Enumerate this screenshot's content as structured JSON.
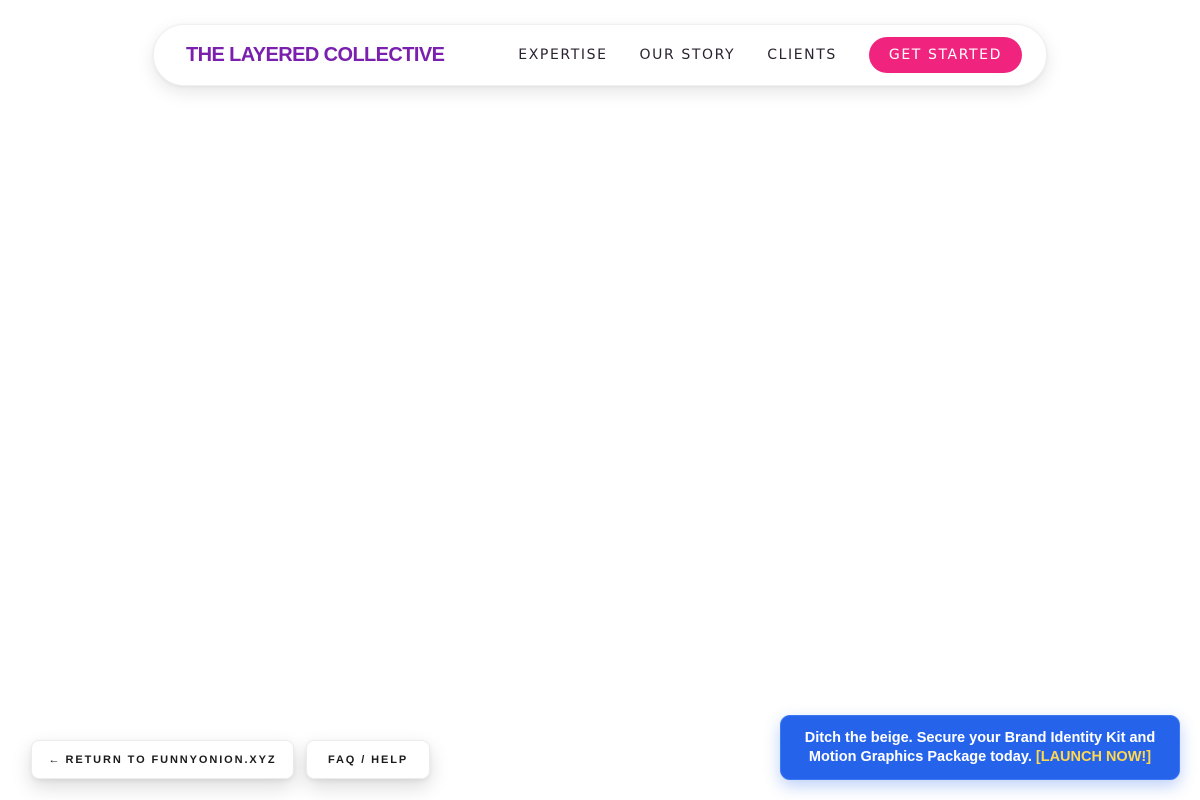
{
  "header": {
    "brand": "THE LAYERED COLLECTIVE",
    "nav": [
      {
        "label": "EXPERTISE"
      },
      {
        "label": "OUR STORY"
      },
      {
        "label": "CLIENTS"
      }
    ],
    "cta_label": "GET STARTED"
  },
  "footer_buttons": {
    "return_arrow": "←",
    "return_label": "RETURN TO FUNNYONION.XYZ",
    "faq_label": "FAQ / HELP"
  },
  "promo": {
    "message": "Ditch the beige. Secure your Brand Identity Kit and Motion Graphics Package today.",
    "link_label": "[LAUNCH NOW!]"
  },
  "colors": {
    "brand": "#7a1fae",
    "cta_background": "#f0247e",
    "promo_background": "#2563eb",
    "promo_link": "#ffd84d"
  }
}
